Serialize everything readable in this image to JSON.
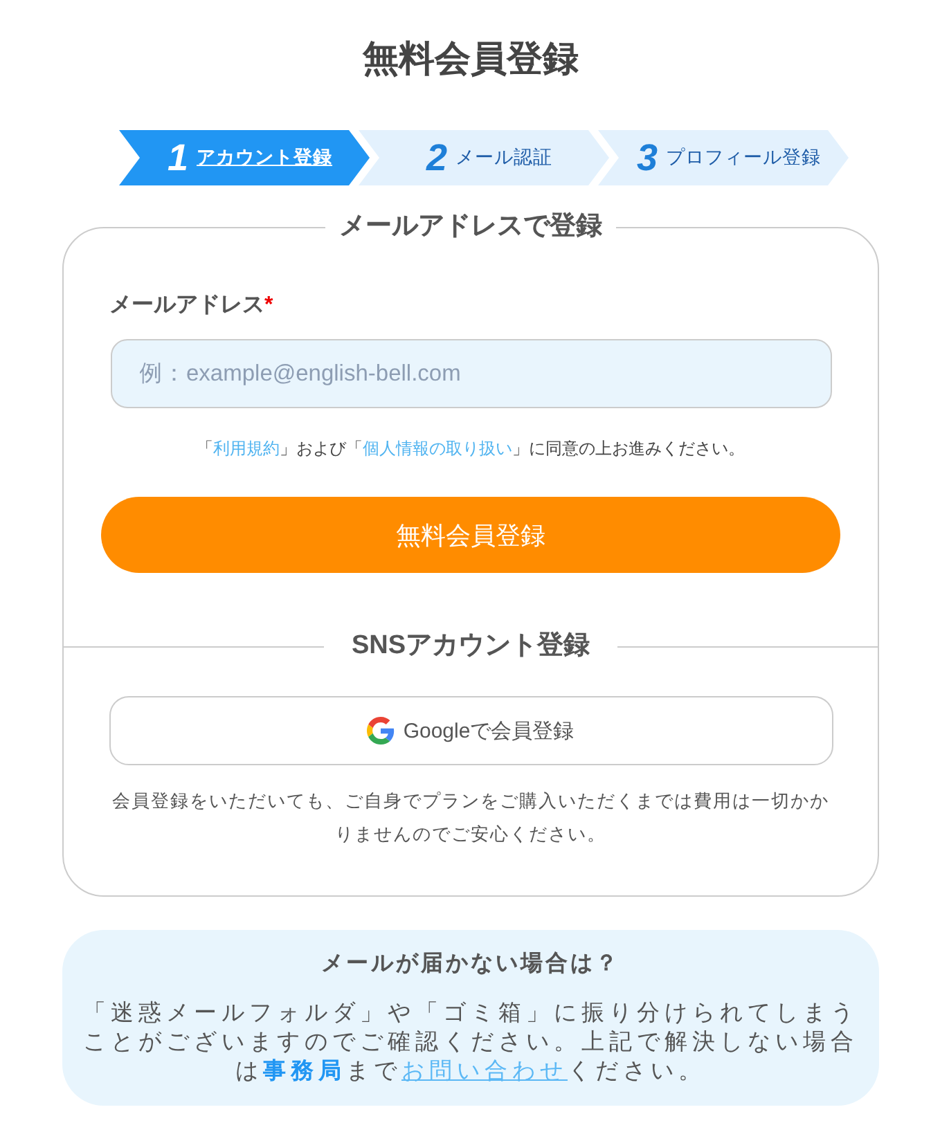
{
  "title": "無料会員登録",
  "steps": [
    {
      "number": "1",
      "label": "アカウント登録",
      "selected": true
    },
    {
      "number": "2",
      "label": "メール認証",
      "selected": false
    },
    {
      "number": "3",
      "label": "プロフィール登録",
      "selected": false
    }
  ],
  "email_section": {
    "heading": "メールアドレスで登録",
    "field": {
      "label": "メールアドレス",
      "required_mark": "*",
      "placeholder": "例：example@english-bell.com"
    },
    "consent": [
      {
        "kind": "text",
        "text": "「"
      },
      {
        "kind": "link",
        "text": "利用規約"
      },
      {
        "kind": "text",
        "text": "」および「"
      },
      {
        "kind": "link",
        "text": "個人情報の取り扱い"
      },
      {
        "kind": "text",
        "text": "」に同意の上お進みください。"
      }
    ],
    "submit_button": "無料会員登録"
  },
  "sns_section": {
    "heading": "SNSアカウント登録",
    "google_button": "Googleで会員登録",
    "note": "会員登録をいただいても、ご自身でプランをご購入いただくまでは費用は一切かかりませんのでご安心ください。"
  },
  "help_box": {
    "title": "メールが届かない場合は？",
    "body": [
      {
        "kind": "text",
        "text": "「迷惑メールフォルダ」や「ゴミ箱」に振り分けられてしまうことがございますのでご確認ください。上記で解決しない場合は"
      },
      {
        "kind": "emphasis",
        "text": "事務局"
      },
      {
        "kind": "text",
        "text": "まで"
      },
      {
        "kind": "link",
        "text": "お問い合わせ"
      },
      {
        "kind": "text",
        "text": "ください。"
      }
    ]
  }
}
